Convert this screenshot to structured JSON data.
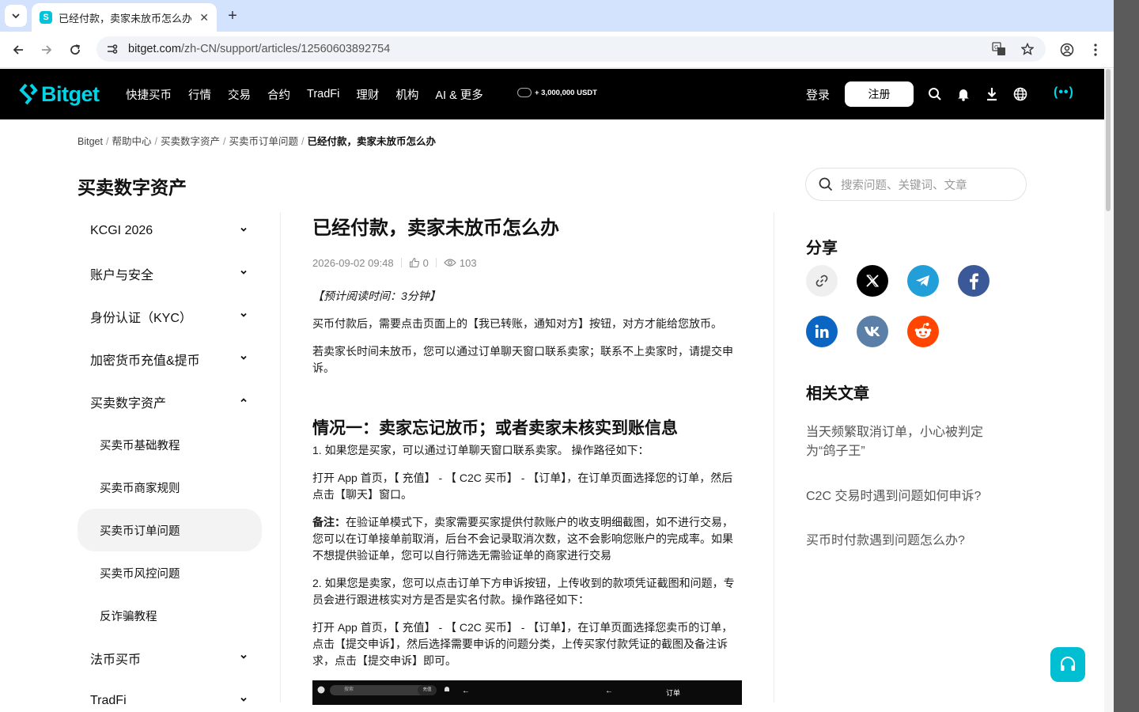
{
  "browser": {
    "tab_title": "已经付款，卖家未放币怎么办",
    "url_host": "bitget.com",
    "url_path": "/zh-CN/support/articles/12560603892754"
  },
  "header": {
    "logo": "Bitget",
    "nav": [
      "快捷买币",
      "行情",
      "交易",
      "合约",
      "TradFi",
      "理财",
      "机构",
      "AI & 更多"
    ],
    "promo": "+ 3,000,000 USDT",
    "login": "登录",
    "signup": "注册",
    "more": "(••)"
  },
  "breadcrumb": [
    "Bitget",
    "帮助中心",
    "买卖数字资产",
    "买卖币订单问题",
    "已经付款，卖家未放币怎么办"
  ],
  "sidebar": {
    "title": "买卖数字资产",
    "items": [
      {
        "label": "KCGI 2026"
      },
      {
        "label": "账户与安全"
      },
      {
        "label": "身份认证（KYC）"
      },
      {
        "label": "加密货币充值&提币"
      },
      {
        "label": "买卖数字资产"
      }
    ],
    "subitems": [
      "买卖币基础教程",
      "买卖币商家规则",
      "买卖币订单问题",
      "买卖币风控问题",
      "反诈骗教程"
    ],
    "after": [
      {
        "label": "法币买币"
      },
      {
        "label": "TradFi"
      }
    ]
  },
  "article": {
    "title": "已经付款，卖家未放币怎么办",
    "date": "2026-09-02 09:48",
    "likes": "0",
    "views": "103",
    "reading_time": "【预计阅读时间：3分钟】",
    "p1": "买币付款后，需要点击页面上的【我已转账，通知对方】按钮，对方才能给您放币。",
    "p2": "若卖家长时间未放币，您可以通过订单聊天窗口联系卖家；联系不上卖家时，请提交申诉。",
    "h2": "情况一：卖家忘记放币；或者卖家未核实到账信息",
    "p3": "1. 如果您是买家，可以通过订单聊天窗口联系卖家。 操作路径如下：",
    "p4": "打开 App 首页，【 充值】 - 【 C2C 买币】 - 【订单】，在订单页面选择您的订单，然后点击【聊天】窗口。",
    "note_label": "备注：",
    "note": "在验证单模式下，卖家需要买家提供付款账户的收支明细截图，如不进行交易，您可以在订单接单前取消，后台不会记录取消次数，这不会影响您账户的完成率。如果不想提供验证单，您可以自行筛选无需验证单的商家进行交易",
    "p5": "2. 如果您是卖家，您可以点击订单下方申诉按钮，上传收到的款项凭证截图和问题，专员会进行跟进核实对方是否是实名付款。操作路径如下：",
    "p6": "打开 App 首页，【 充值】 - 【 C2C 买币】 - 【订单】，在订单页面选择您卖币的订单，点击【提交申诉】，然后选择需要申诉的问题分类，上传买家付款凭证的截图及备注诉求，点击【提交申诉】即可。",
    "img_search": "搜索",
    "img_btn": "充值",
    "img_label": "订单"
  },
  "right": {
    "search_placeholder": "搜索问题、关键词、文章",
    "share_title": "分享",
    "related_title": "相关文章",
    "related": [
      "当天频繁取消订单，小心被判定为“鸽子王”",
      "C2C 交易时遇到问题如何申诉?",
      "买币时付款遇到问题怎么办?"
    ]
  },
  "colors": {
    "brand": "#00d4e6",
    "support": "#00bfd3"
  }
}
